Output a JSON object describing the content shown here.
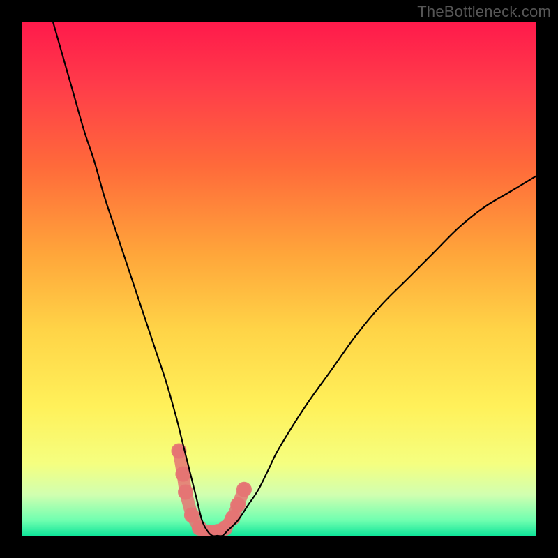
{
  "watermark": "TheBottleneck.com",
  "chart_data": {
    "type": "line",
    "title": "",
    "xlabel": "",
    "ylabel": "",
    "xlim": [
      0,
      100
    ],
    "ylim": [
      0,
      100
    ],
    "background_gradient_stops": [
      {
        "pos": 0.0,
        "color": "#ff1a4b"
      },
      {
        "pos": 0.12,
        "color": "#ff3b4a"
      },
      {
        "pos": 0.28,
        "color": "#ff6a3a"
      },
      {
        "pos": 0.45,
        "color": "#ffa53a"
      },
      {
        "pos": 0.6,
        "color": "#ffd447"
      },
      {
        "pos": 0.75,
        "color": "#fff15a"
      },
      {
        "pos": 0.86,
        "color": "#f5ff80"
      },
      {
        "pos": 0.92,
        "color": "#d1ffb0"
      },
      {
        "pos": 0.97,
        "color": "#70ffb0"
      },
      {
        "pos": 1.0,
        "color": "#10e59a"
      }
    ],
    "series": [
      {
        "name": "main-curve",
        "color": "#000000",
        "x": [
          6,
          8,
          10,
          12,
          14,
          16,
          18,
          20,
          22,
          24,
          26,
          28,
          30,
          31,
          32,
          33,
          34,
          35,
          36,
          37,
          38,
          39,
          40,
          42,
          44,
          46,
          48,
          50,
          55,
          60,
          65,
          70,
          75,
          80,
          85,
          90,
          95,
          100
        ],
        "y": [
          100,
          93,
          86,
          79,
          73,
          66,
          60,
          54,
          48,
          42,
          36,
          30,
          23,
          19,
          15,
          11,
          7,
          3,
          1,
          0,
          0,
          0,
          1,
          3,
          6,
          9,
          13,
          17,
          25,
          32,
          39,
          45,
          50,
          55,
          60,
          64,
          67,
          70
        ]
      },
      {
        "name": "marker-cluster",
        "color": "#e57373",
        "type": "scatter",
        "x": [
          30.5,
          31.3,
          31.8,
          33.0,
          34.5,
          36.0,
          37.2,
          38.0,
          39.5,
          41.0,
          42.0,
          43.2
        ],
        "y": [
          16.5,
          12.0,
          8.5,
          4.0,
          1.5,
          0.7,
          0.7,
          0.8,
          1.5,
          3.5,
          6.0,
          9.0
        ]
      }
    ]
  }
}
